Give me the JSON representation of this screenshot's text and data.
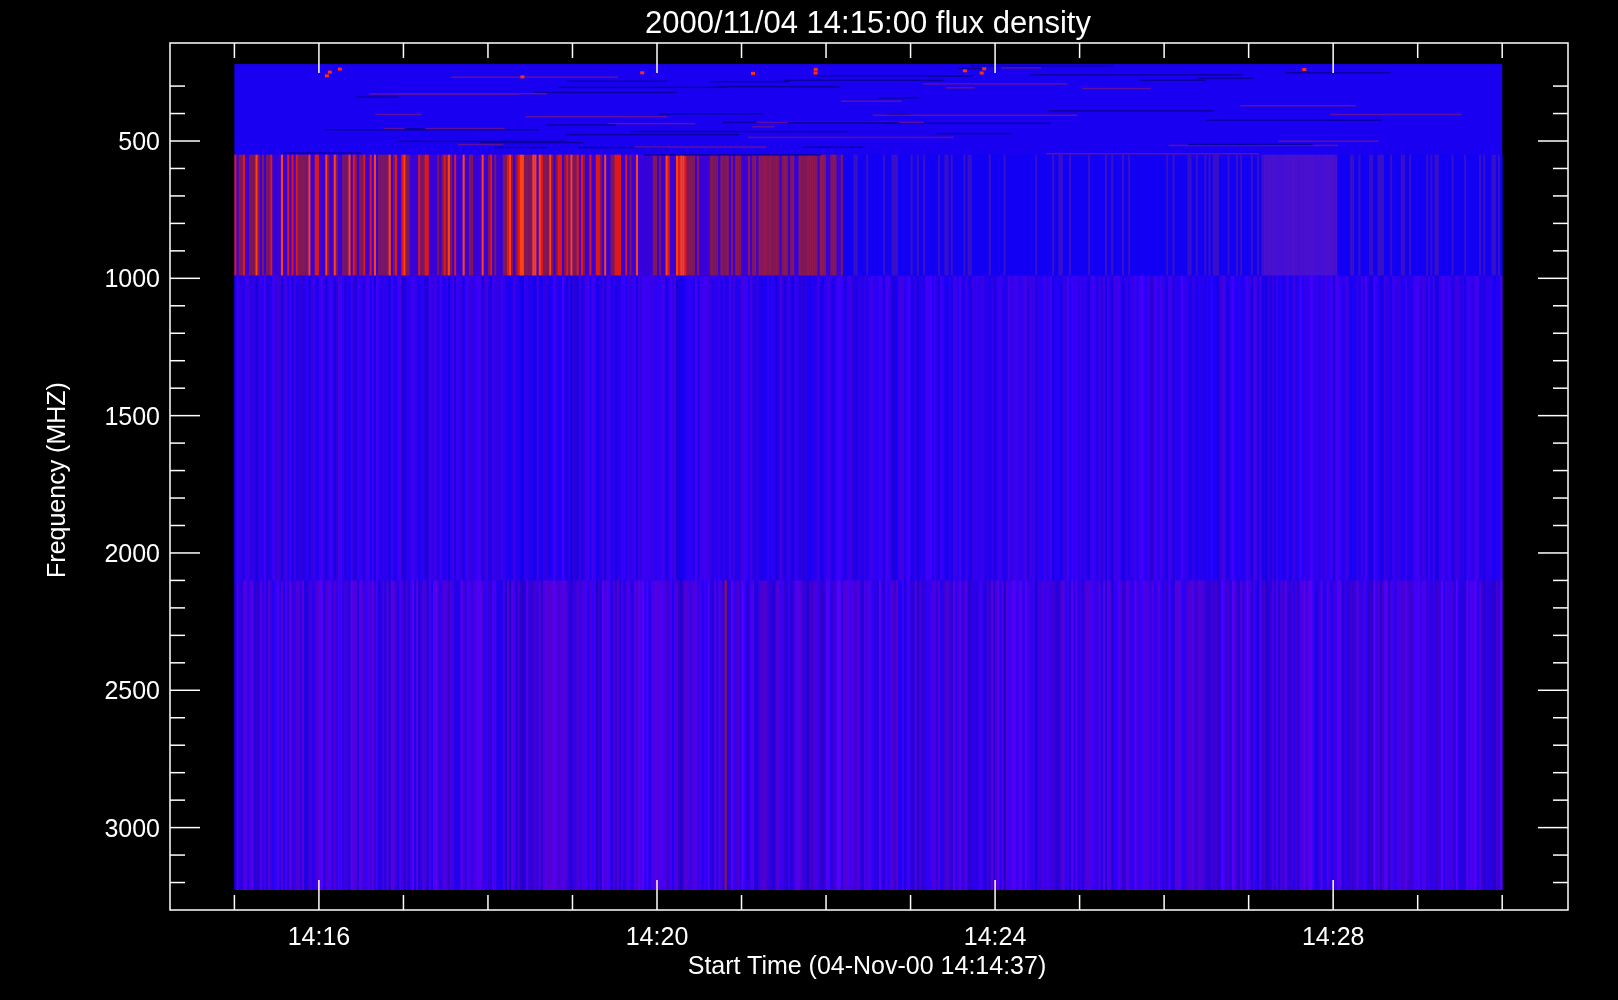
{
  "title": "2000/11/04 14:15:00 flux density",
  "y_axis": {
    "label": "Frequency (MHZ)",
    "ticks": [
      "500",
      "1000",
      "1500",
      "2000",
      "2500",
      "3000"
    ]
  },
  "x_axis": {
    "label": "Start Time (04-Nov-00 14:14:37)",
    "ticks": [
      "14:16",
      "14:20",
      "14:24",
      "14:28"
    ]
  }
}
